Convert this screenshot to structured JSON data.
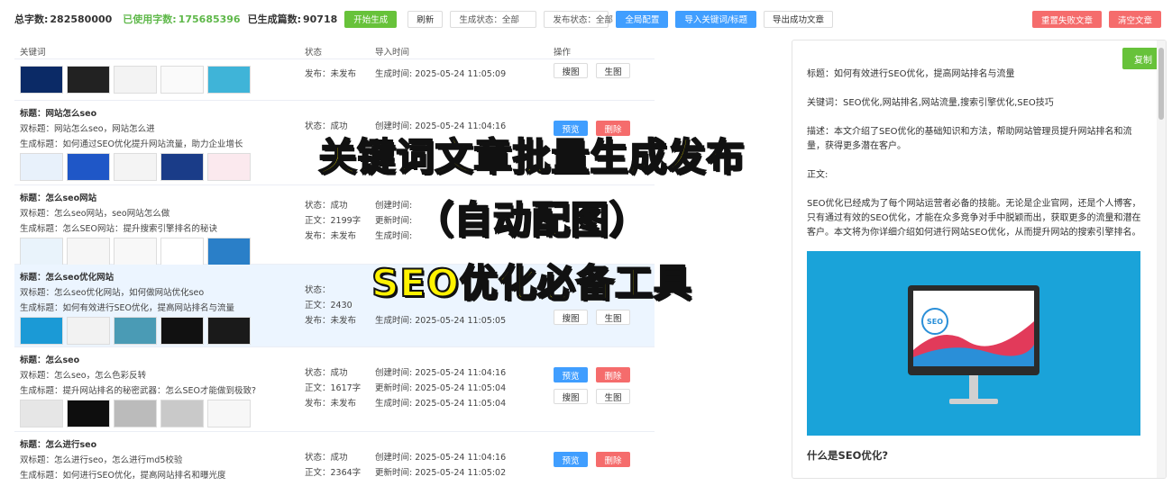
{
  "toolbar": {
    "total_label": "总字数:",
    "total_value": "282580000",
    "used_label": "已使用字数:",
    "used_value": "175685396",
    "generated_label": "已生成篇数:",
    "generated_value": "90718",
    "start_btn": "开始生成",
    "refresh_btn": "刷新",
    "gen_status_filter": "生成状态：全部",
    "pub_status_filter": "发布状态：全部",
    "global_config_btn": "全局配置",
    "import_btn": "导入关键词/标题",
    "export_btn": "导出成功文章",
    "regen_failed_btn": "重置失败文章",
    "clear_btn": "清空文章"
  },
  "table": {
    "headers": {
      "keyword": "关键词",
      "status": "状态",
      "import_time": "导入时间",
      "actions": "操作"
    },
    "rows": [
      {
        "title": "",
        "sub": "",
        "gen": "",
        "status": [
          "",
          "",
          "发布：未发布"
        ],
        "times": [
          "",
          "",
          "生成时间:   2025-05-24 11:05:09"
        ],
        "buttons": [
          "搜图",
          "生图"
        ]
      },
      {
        "title": "标题：网站怎么seo",
        "sub": "双标题：网站怎么seo，网站怎么进",
        "gen": "生成标题：如何通过SEO优化提升网站流量，助力企业增长",
        "status": [
          "状态：成功",
          "",
          ""
        ],
        "times": [
          "创建时间:   2025-05-24 11:04:16",
          "",
          ""
        ],
        "buttons": [
          "预览",
          "删除"
        ]
      },
      {
        "title": "标题：怎么seo网站",
        "sub": "双标题：怎么seo网站，seo网站怎么做",
        "gen": "生成标题：怎么SEO网站：提升搜索引擎排名的秘诀",
        "status": [
          "状态：成功",
          "正文：2199字",
          "发布：未发布"
        ],
        "times": [
          "创建时间:",
          "更新时间:",
          "生成时间:"
        ],
        "buttons": []
      },
      {
        "title": "标题：怎么seo优化网站",
        "sub": "双标题：怎么seo优化网站，如何做网站优化seo",
        "gen": "生成标题：如何有效进行SEO优化，提高网站排名与流量",
        "status": [
          "状态：",
          "正文：2430",
          "发布：未发布"
        ],
        "times": [
          "",
          "",
          "生成时间:   2025-05-24 11:05:05"
        ],
        "buttons": [
          "搜图",
          "生图"
        ]
      },
      {
        "title": "标题：怎么seo",
        "sub": "双标题：怎么seo，怎么色彩反转",
        "gen": "生成标题：提升网站排名的秘密武器：怎么SEO才能做到极致?",
        "status": [
          "状态：成功",
          "正文：1617字",
          "发布：未发布"
        ],
        "times": [
          "创建时间:   2025-05-24 11:04:16",
          "更新时间:   2025-05-24 11:05:04",
          "生成时间:   2025-05-24 11:05:04"
        ],
        "buttons": [
          "预览",
          "删除",
          "搜图",
          "生图"
        ]
      },
      {
        "title": "标题：怎么进行seo",
        "sub": "双标题：怎么进行seo，怎么进行md5校验",
        "gen": "生成标题：如何进行SEO优化，提高网站排名和曝光度",
        "status": [
          "状态：成功",
          "正文：2364字",
          ""
        ],
        "times": [
          "创建时间:   2025-05-24 11:04:16",
          "更新时间:   2025-05-24 11:05:02",
          ""
        ],
        "buttons": [
          "预览",
          "删除"
        ]
      }
    ]
  },
  "preview": {
    "copy_btn": "复制",
    "title": "标题：如何有效进行SEO优化，提高网站排名与流量",
    "keywords": "关键词：SEO优化,网站排名,网站流量,搜索引擎优化,SEO技巧",
    "desc": "描述：本文介绍了SEO优化的基础知识和方法，帮助网站管理员提升网站排名和流量，获得更多潜在客户。",
    "body_label": "正文:",
    "body": "SEO优化已经成为了每个网站运营者必备的技能。无论是企业官网，还是个人博客，只有通过有效的SEO优化，才能在众多竞争对手中脱颖而出，获取更多的流量和潜在客户。本文将为你详细介绍如何进行网站SEO优化，从而提升网站的搜索引擎排名。",
    "img_text": "SEO",
    "heading": "什么是SEO优化?"
  },
  "overlay": {
    "line1": "关键词文章批量生成发布",
    "line2": "（自动配图）",
    "line3": "SEO优化必备工具"
  },
  "colors": {
    "green": "#67c23a",
    "blue": "#409eff",
    "red": "#f56c6c",
    "overlay_yellow": "#fff200"
  }
}
